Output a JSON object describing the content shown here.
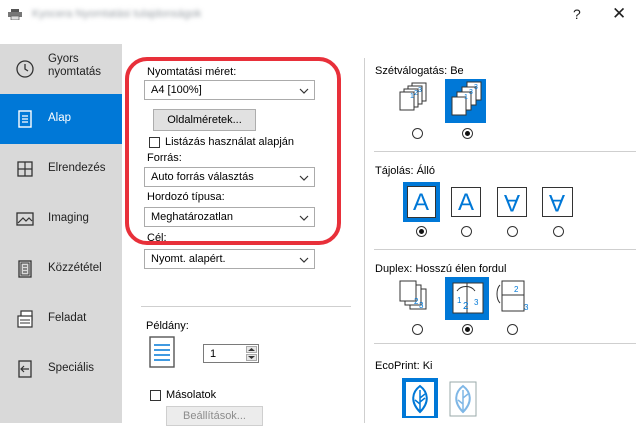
{
  "window": {
    "title": "Kyocera Nyomtatási tulajdonságok",
    "help": "?",
    "close": "✕"
  },
  "sidebar": {
    "items": [
      {
        "label": "Gyors nyomtatás",
        "icon": "clock-icon"
      },
      {
        "label": "Alap",
        "icon": "document-icon",
        "active": true
      },
      {
        "label": "Elrendezés",
        "icon": "layout-grid-icon"
      },
      {
        "label": "Imaging",
        "icon": "image-icon"
      },
      {
        "label": "Közzététel",
        "icon": "booklet-icon"
      },
      {
        "label": "Feladat",
        "icon": "job-stack-icon"
      },
      {
        "label": "Speciális",
        "icon": "advanced-arrow-icon"
      }
    ]
  },
  "basic": {
    "print_size_label": "Nyomtatási méret:",
    "print_size_value": "A4  [100%]",
    "page_sizes_button": "Oldalméretek...",
    "list_check_label": "Listázás használat alapján",
    "source_label": "Forrás:",
    "source_value": "Auto forrás választás",
    "media_label": "Hordozó típusa:",
    "media_value": "Meghatározatlan",
    "dest_label": "Cél:",
    "dest_value": "Nyomt. alapért.",
    "copies_label": "Példány:",
    "copies_value": "1",
    "collate_check_label": "Másolatok",
    "settings_button": "Beállítások..."
  },
  "right": {
    "collation_label": "Szétválogatás:",
    "collation_value": "Be",
    "orientation_label": "Tájolás:",
    "orientation_value": "Álló",
    "duplex_label": "Duplex:",
    "duplex_value": "Hosszú élen fordul",
    "ecoprint_label": "EcoPrint:",
    "ecoprint_value": "Ki",
    "orientation_glyph": "A",
    "page_nums": [
      "1",
      "2",
      "3"
    ]
  },
  "colors": {
    "accent": "#0078d7",
    "highlight": "#e8303a",
    "sidebar": "#d9d9d9"
  }
}
